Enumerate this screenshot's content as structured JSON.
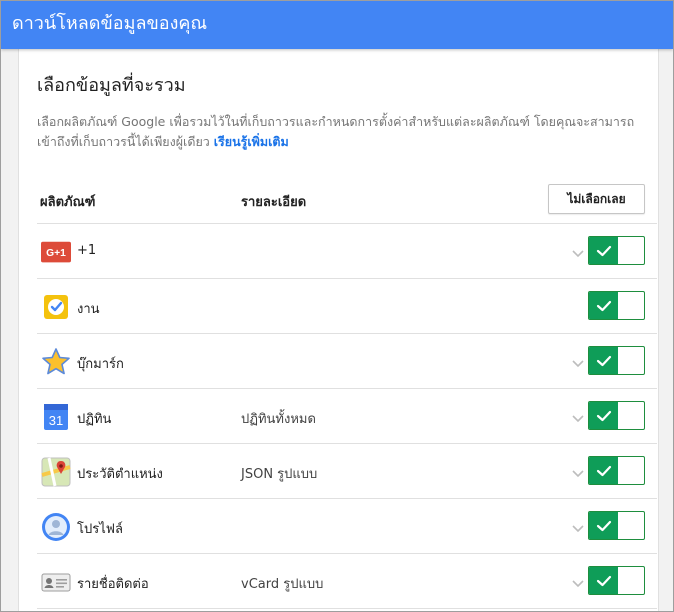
{
  "header": {
    "title": "ดาวน์โหลดข้อมูลของคุณ"
  },
  "section": {
    "title": "เลือกข้อมูลที่จะรวม",
    "description": "เลือกผลิตภัณฑ์ Google เพื่อรวมไว้ในที่เก็บถาวรและกำหนดการตั้งค่าสำหรับแต่ละผลิตภัณฑ์ โดยคุณจะสามารถเข้าถึงที่เก็บถาวรนี้ได้เพียงผู้เดียว",
    "learn_more": "เรียนรู้เพิ่มเติม"
  },
  "table": {
    "col_product": "ผลิตภัณฑ์",
    "col_details": "รายละเอียด",
    "deselect_all": "ไม่เลือกเลย",
    "rows": [
      {
        "icon": "google-plus-one-icon",
        "name": "+1",
        "detail": "",
        "expandable": true,
        "enabled": true
      },
      {
        "icon": "tasks-icon",
        "name": "งาน",
        "detail": "",
        "expandable": false,
        "enabled": true
      },
      {
        "icon": "bookmarks-star-icon",
        "name": "บุ๊กมาร์ก",
        "detail": "",
        "expandable": true,
        "enabled": true
      },
      {
        "icon": "calendar-icon",
        "name": "ปฏิทิน",
        "detail": "ปฏิทินทั้งหมด",
        "expandable": true,
        "enabled": true
      },
      {
        "icon": "location-history-map-icon",
        "name": "ประวัติตำแหน่ง",
        "detail": "JSON รูปแบบ",
        "expandable": true,
        "enabled": true
      },
      {
        "icon": "profile-icon",
        "name": "โปรไฟล์",
        "detail": "",
        "expandable": true,
        "enabled": true
      },
      {
        "icon": "contacts-card-icon",
        "name": "รายชื่อติดต่อ",
        "detail": "vCard รูปแบบ",
        "expandable": true,
        "enabled": true
      }
    ]
  },
  "icons": {
    "calendar_day": "31",
    "gplus_label": "G+1"
  },
  "colors": {
    "header_blue": "#4285f4",
    "toggle_green": "#0f9d58",
    "link_blue": "#1a73e8"
  }
}
